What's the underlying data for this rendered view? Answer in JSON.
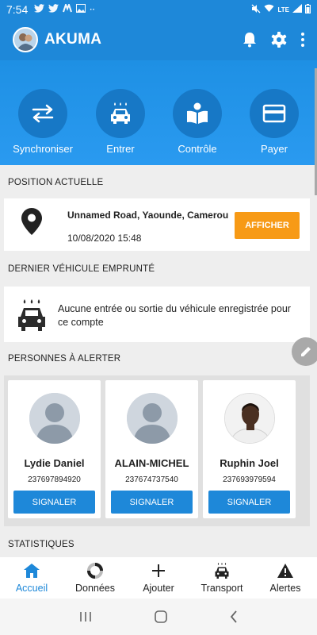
{
  "status_bar": {
    "time": "7:54",
    "network": "LTE"
  },
  "app": {
    "title": "AKUMA"
  },
  "quick_actions": [
    {
      "label": "Synchroniser",
      "icon": "sync-arrows-icon"
    },
    {
      "label": "Entrer",
      "icon": "car-wash-icon"
    },
    {
      "label": "Contrôle",
      "icon": "book-reader-icon"
    },
    {
      "label": "Payer",
      "icon": "credit-card-icon"
    }
  ],
  "position": {
    "section_title": "POSITION ACTUELLE",
    "address": "Unnamed Road, Yaounde, Camerou",
    "datetime": "10/08/2020 15:48",
    "button": "AFFICHER"
  },
  "vehicle": {
    "section_title": "DERNIER VÉHICULE EMPRUNTÉ",
    "message": "Aucune entrée ou sortie du véhicule enregistrée pour ce compte"
  },
  "alert_persons": {
    "section_title": "PERSONNES À ALERTER",
    "button_label": "SIGNALER",
    "persons": [
      {
        "name": "Lydie Daniel",
        "phone": "237697894920"
      },
      {
        "name": "ALAIN-MICHEL",
        "phone": "237674737540"
      },
      {
        "name": "Ruphin Joel",
        "phone": "237693979594"
      }
    ]
  },
  "statistics": {
    "section_title": "STATISTIQUES"
  },
  "bottom_nav": [
    {
      "label": "Accueil",
      "active": true
    },
    {
      "label": "Données",
      "active": false
    },
    {
      "label": "Ajouter",
      "active": false
    },
    {
      "label": "Transport",
      "active": false
    },
    {
      "label": "Alertes",
      "active": false
    }
  ],
  "colors": {
    "primary": "#1e88d9",
    "accent": "#f79a16"
  }
}
